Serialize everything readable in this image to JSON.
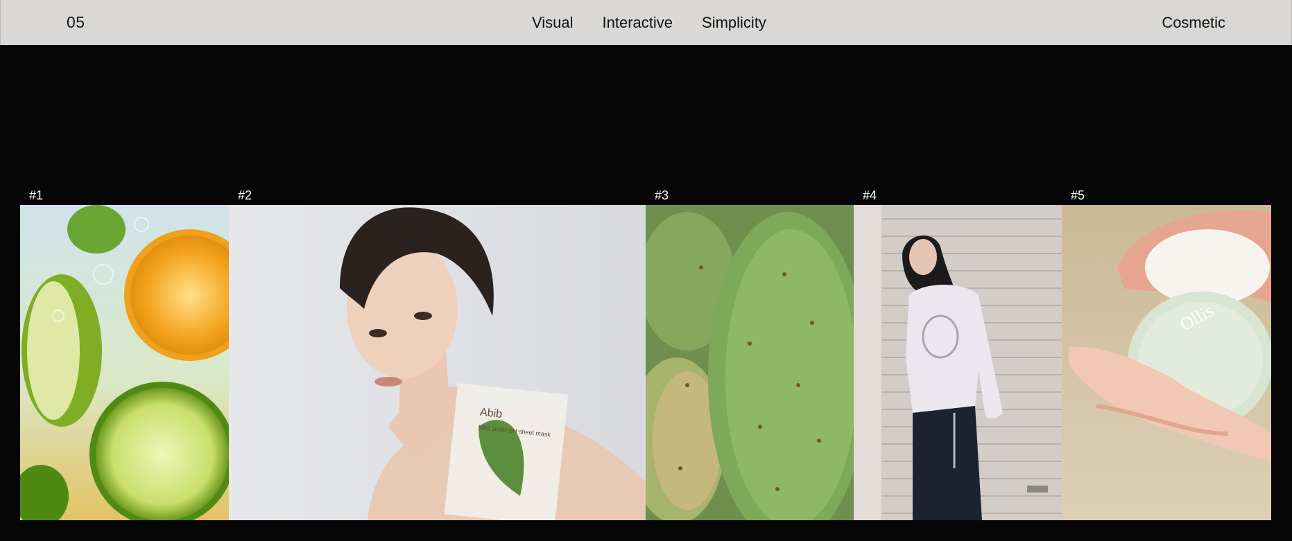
{
  "header": {
    "index": "05",
    "nav": [
      "Visual",
      "Interactive",
      "Simplicity"
    ],
    "brand": "Cosmetic"
  },
  "gallery": {
    "items": [
      {
        "label": "#1",
        "subject": "citrus-slices-image"
      },
      {
        "label": "#2",
        "subject": "model-with-sheet-mask-image",
        "product_text": "Abib",
        "product_subtext": "Mild acidic pH sheet mask"
      },
      {
        "label": "#3",
        "subject": "cactus-pads-image"
      },
      {
        "label": "#4",
        "subject": "model-in-sweatshirt-image"
      },
      {
        "label": "#5",
        "subject": "hands-with-soap-bar-image",
        "product_text": "Ollis"
      }
    ]
  }
}
